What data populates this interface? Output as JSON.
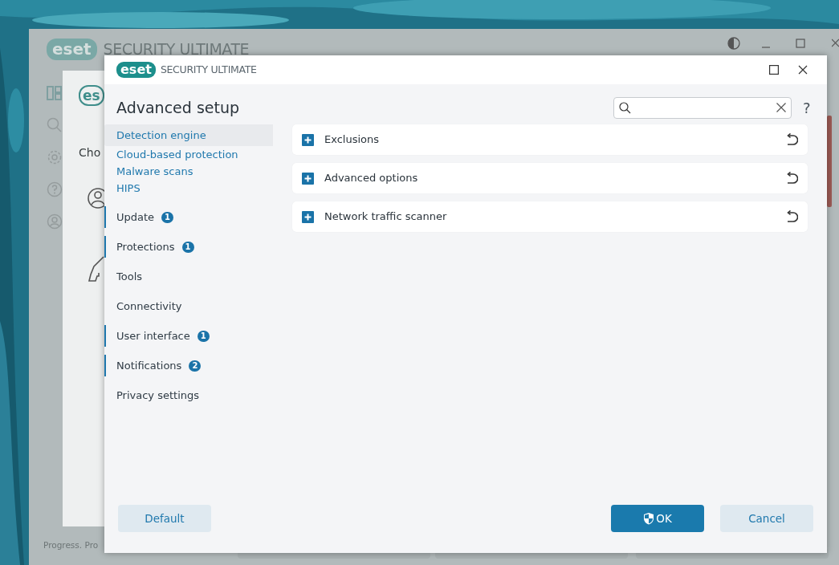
{
  "background_window": {
    "logo": "eset",
    "brand": "SECURITY ULTIMATE",
    "panel_logo": "es",
    "heading": "Cho",
    "footer": "Progress. Pro"
  },
  "dialog": {
    "logo": "eset",
    "brand": "SECURITY ULTIMATE",
    "title": "Advanced setup",
    "help": "?"
  },
  "sidebar": {
    "items": [
      {
        "label": "Detection engine",
        "selected": true,
        "expanded": true,
        "modified": false,
        "children": [
          {
            "label": "Cloud-based protection",
            "selected": false
          },
          {
            "label": "Malware scans",
            "selected": false
          },
          {
            "label": "HIPS",
            "selected": false
          }
        ]
      },
      {
        "label": "Update",
        "selected": false,
        "expanded": false,
        "modified": true,
        "badge": "1"
      },
      {
        "label": "Protections",
        "selected": false,
        "expanded": false,
        "modified": true,
        "badge": "1"
      },
      {
        "label": "Tools",
        "selected": false,
        "expanded": false,
        "modified": false
      },
      {
        "label": "Connectivity",
        "selected": false,
        "expanded": false,
        "modified": false
      },
      {
        "label": "User interface",
        "selected": false,
        "expanded": false,
        "modified": true,
        "badge": "1"
      },
      {
        "label": "Notifications",
        "selected": false,
        "expanded": false,
        "modified": true,
        "badge": "2"
      },
      {
        "label": "Privacy settings",
        "selected": false,
        "expanded": false,
        "modified": false
      }
    ]
  },
  "sections": [
    {
      "label": "Exclusions",
      "expanded": false
    },
    {
      "label": "Advanced options",
      "expanded": false
    },
    {
      "label": "Network traffic scanner",
      "expanded": false
    }
  ],
  "buttons": [
    {
      "label": "Default",
      "kind": "secondary"
    },
    {
      "label": "OK",
      "kind": "primary"
    },
    {
      "label": "Cancel",
      "kind": "secondary"
    }
  ]
}
